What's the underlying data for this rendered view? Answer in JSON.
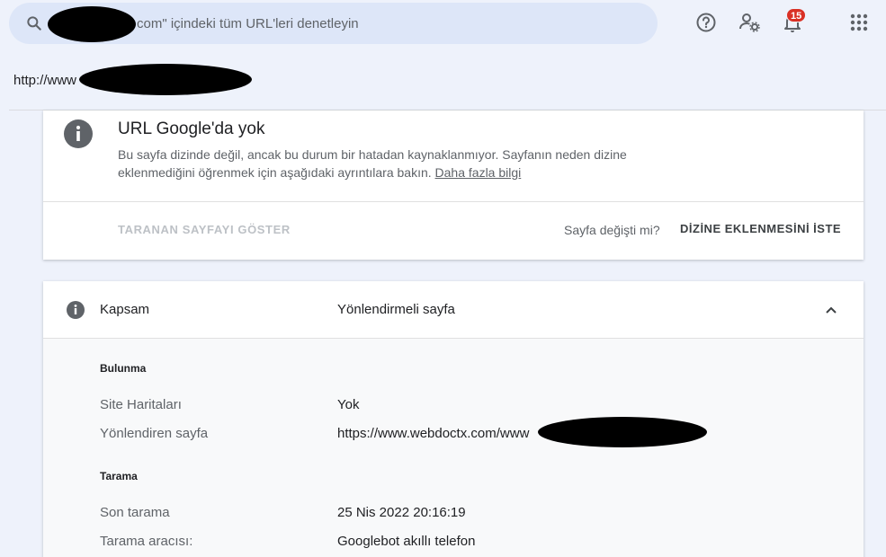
{
  "search": {
    "placeholder_suffix": "com\" içindeki tüm URL'leri denetleyin"
  },
  "header": {
    "notification_count": "15",
    "icons": [
      "help-icon",
      "manage-accounts-icon",
      "notifications-icon",
      "apps-grid-icon"
    ]
  },
  "url": {
    "prefix": "http://www"
  },
  "status_card": {
    "title": "URL Google'da yok",
    "description": "Bu sayfa dizinde değil, ancak bu durum bir hatadan kaynaklanmıyor. Sayfanın neden dizine eklenmediğini öğrenmek için aşağıdaki ayrıntılara bakın.",
    "learn_more": "Daha fazla bilgi",
    "view_crawled": "TARANAN SAYFAYI GÖSTER",
    "changed_question": "Sayfa değişti mi?",
    "request_indexing": "DİZİNE EKLENMESİNİ İSTE"
  },
  "coverage": {
    "label": "Kapsam",
    "value": "Yönlendirmeli sayfa",
    "sections": [
      {
        "title": "Bulunma",
        "rows": [
          {
            "label": "Site Haritaları",
            "value": "Yok"
          },
          {
            "label": "Yönlendiren sayfa",
            "value": "https://www.webdoctx.com/www"
          }
        ]
      },
      {
        "title": "Tarama",
        "rows": [
          {
            "label": "Son tarama",
            "value": "25 Nis 2022 20:16:19"
          },
          {
            "label": "Tarama aracısı:",
            "value": "Googlebot akıllı telefon"
          }
        ]
      }
    ]
  },
  "colors": {
    "background": "#eef2fb",
    "search_bg": "#dde6f8",
    "badge": "#d93025",
    "info_icon": "#5f6368"
  }
}
